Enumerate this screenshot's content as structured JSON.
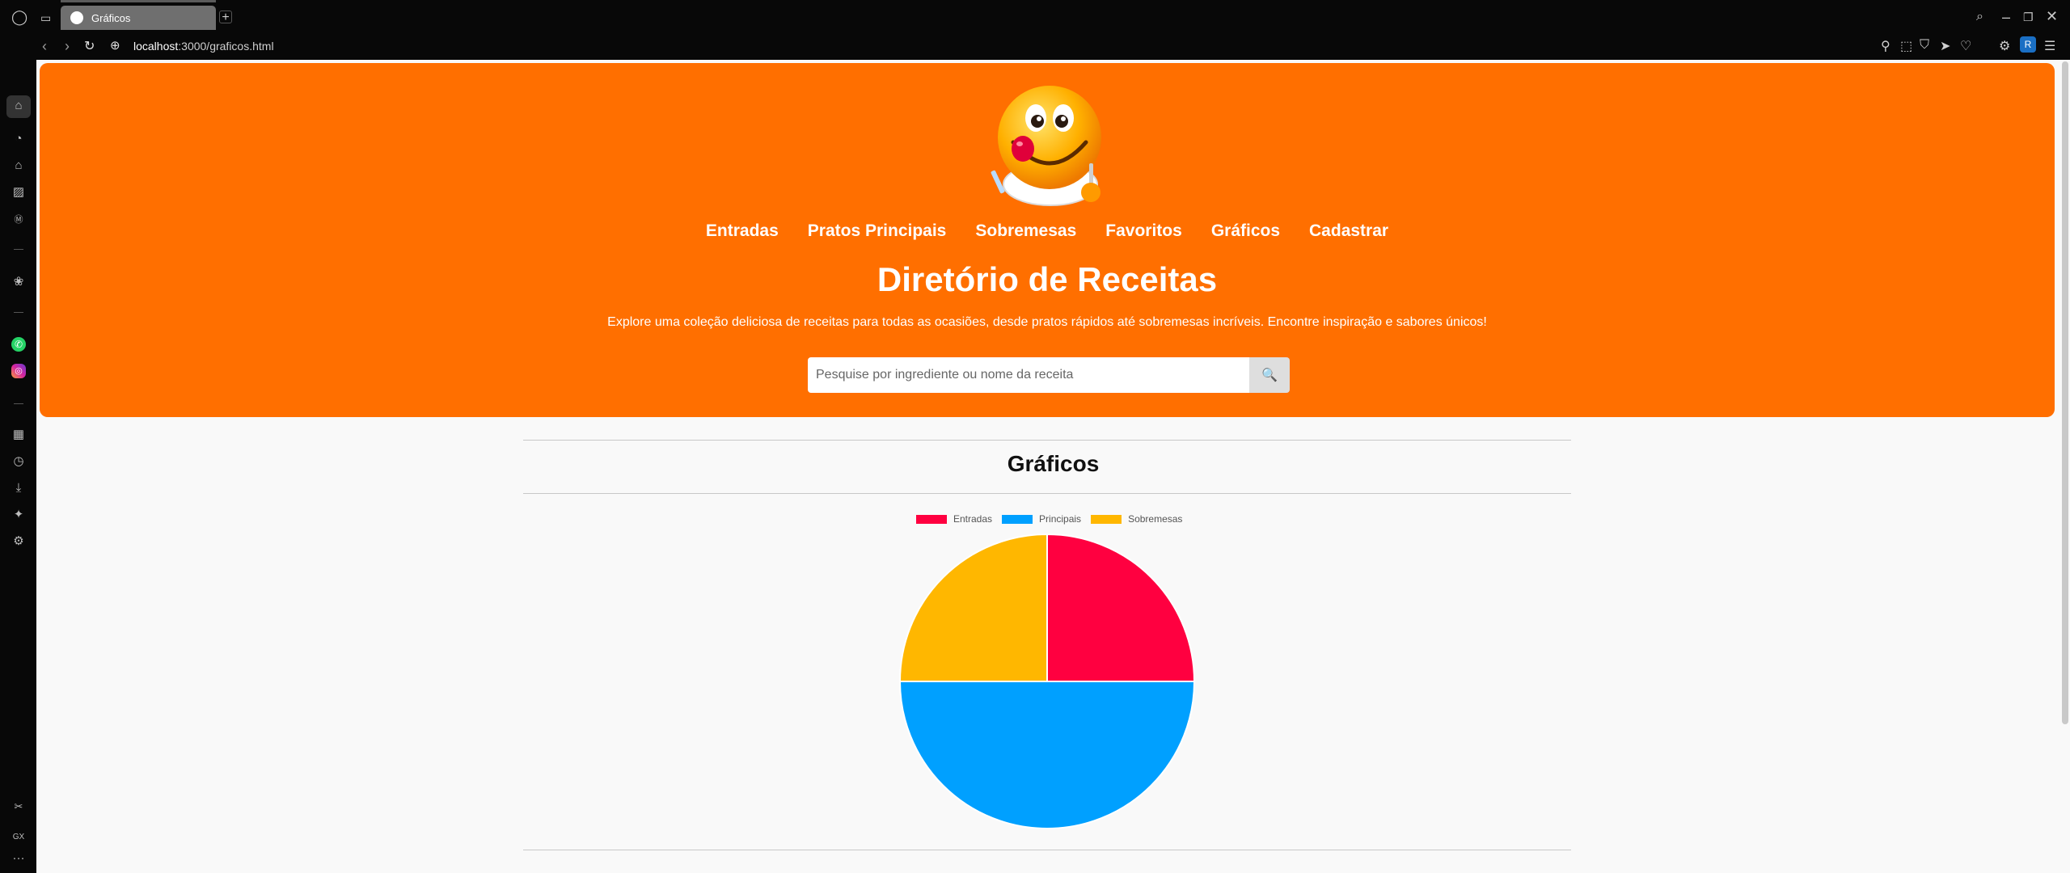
{
  "browser": {
    "tab_title": "Gráficos",
    "url_host": "localhost",
    "url_rest": ":3000/graficos.html",
    "profile_initial": "R"
  },
  "sidebar": {
    "items": [
      "home-icon",
      "speed-dial-icon",
      "easy-setup-icon",
      "player-icon",
      "m-icon",
      "chatgpt-icon",
      "whatsapp-icon",
      "instagram-icon",
      "workspaces-icon",
      "history-icon",
      "downloads-icon",
      "extensions-icon",
      "settings-icon",
      "gx-icon",
      "more-icon"
    ],
    "gx_label": "GX",
    "more_label": "···"
  },
  "site": {
    "nav": [
      "Entradas",
      "Pratos Principais",
      "Sobremesas",
      "Favoritos",
      "Gráficos",
      "Cadastrar"
    ],
    "title": "Diretório de Receitas",
    "subtitle": "Explore uma coleção deliciosa de receitas para todas as ocasiões, desde pratos rápidos até sobremesas incríveis. Encontre inspiração e sabores únicos!",
    "search_placeholder": "Pesquise por ingrediente ou nome da receita",
    "search_button": "🔍",
    "header_color": "#ff6f00"
  },
  "section": {
    "title": "Gráficos"
  },
  "chart_data": {
    "type": "pie",
    "categories": [
      "Entradas",
      "Principais",
      "Sobremesas"
    ],
    "values": [
      1,
      2,
      1
    ],
    "colors": [
      "#ff0040",
      "#00a0ff",
      "#ffb700"
    ],
    "legend_position": "top"
  }
}
